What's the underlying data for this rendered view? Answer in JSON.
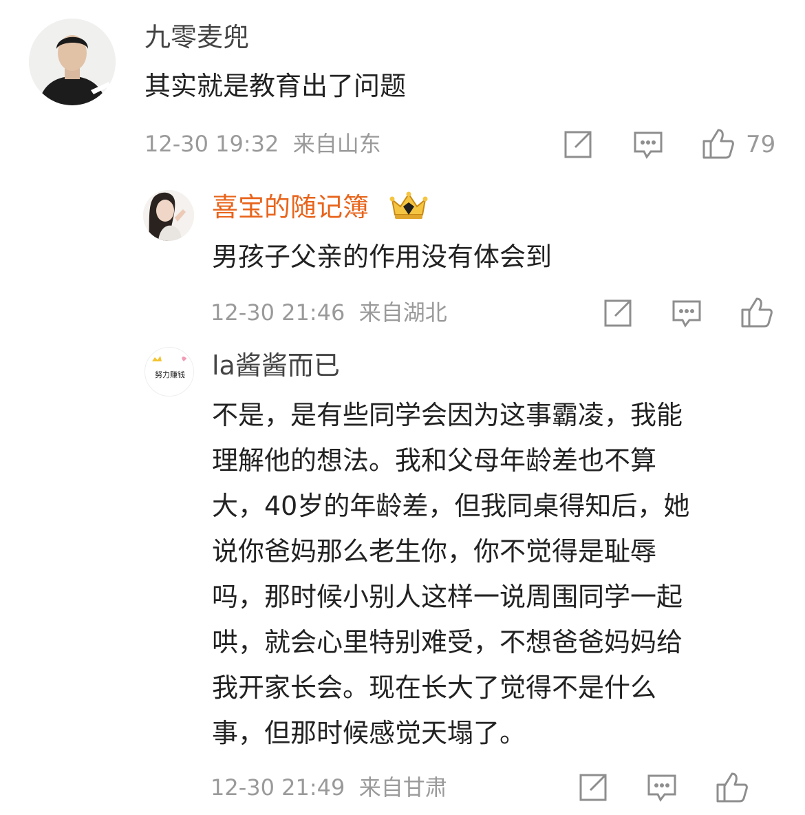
{
  "comments": [
    {
      "username": "九零麦兜",
      "text": "其实就是教育出了问题",
      "time": "12-30 19:32",
      "location": "来自山东",
      "like_count": "79"
    },
    {
      "username": "喜宝的随记簿",
      "username_color": "#e8641b",
      "badge": "crown-badge",
      "text": "男孩子父亲的作用没有体会到",
      "time": "12-30 21:46",
      "location": "来自湖北"
    },
    {
      "username": "la酱酱而已",
      "avatar_text": "努力赚钱",
      "text_lines": [
        "不是，是有些同学会因为这事霸凌，我能",
        "理解他的想法。我和父母年龄差也不算",
        "大，40岁的年龄差，但我同桌得知后，她",
        "说你爸妈那么老生你，你不觉得是耻辱",
        "吗，那时候小别人这样一说周围同学一起",
        "哄，就会心里特别难受，不想爸爸妈妈给",
        "我开家长会。现在长大了觉得不是什么",
        "事，但那时候感觉天塌了。"
      ],
      "time": "12-30 21:49",
      "location": "来自甘肃"
    }
  ],
  "icons": {
    "share": "share-icon",
    "comment": "comment-icon",
    "like": "thumbs-up-icon"
  },
  "colors": {
    "text": "#222222",
    "meta": "#9a9a9a",
    "vip_name": "#e8641b"
  }
}
